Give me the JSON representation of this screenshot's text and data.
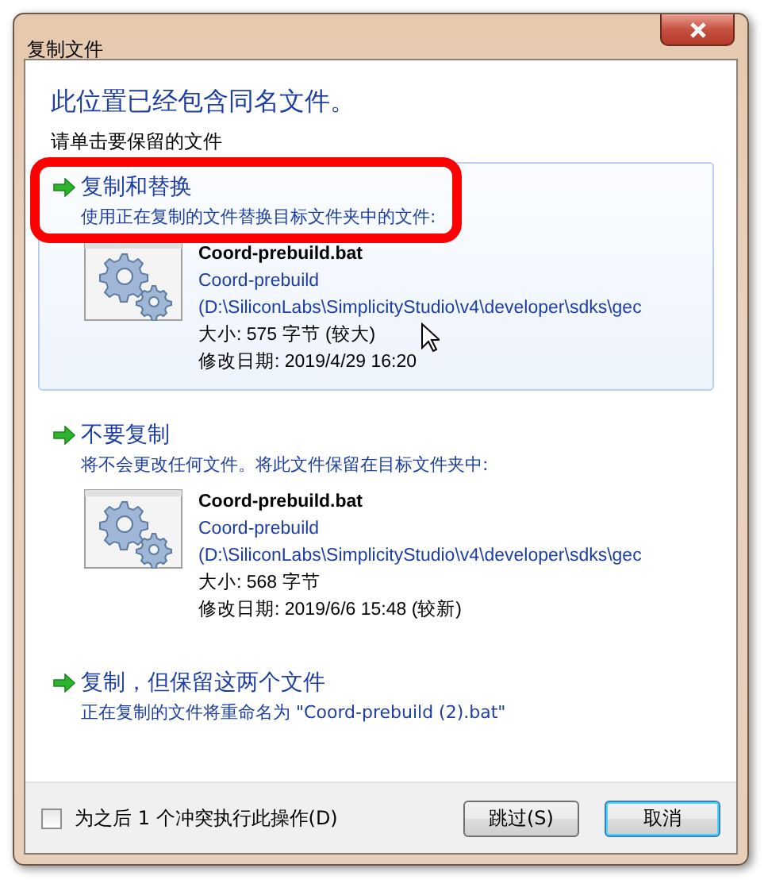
{
  "window": {
    "title": "复制文件"
  },
  "heading": "此位置已经包含同名文件。",
  "subheading": "请单击要保留的文件",
  "options": [
    {
      "title": "复制和替换",
      "description": "使用正在复制的文件替换目标文件夹中的文件:",
      "highlighted": true,
      "annotated": true,
      "file": {
        "name": "Coord-prebuild.bat",
        "folder": "Coord-prebuild",
        "path": "(D:\\SiliconLabs\\SimplicityStudio\\v4\\developer\\sdks\\gec",
        "size": "大小: 575 字节 (较大)",
        "modified": "修改日期: 2019/4/29 16:20"
      }
    },
    {
      "title": "不要复制",
      "description": "将不会更改任何文件。将此文件保留在目标文件夹中:",
      "highlighted": false,
      "annotated": false,
      "file": {
        "name": "Coord-prebuild.bat",
        "folder": "Coord-prebuild",
        "path": "(D:\\SiliconLabs\\SimplicityStudio\\v4\\developer\\sdks\\gec",
        "size": "大小: 568 字节",
        "modified": "修改日期: 2019/6/6 15:48 (较新)"
      }
    },
    {
      "title": "复制，但保留这两个文件",
      "description": "正在复制的文件将重命名为 \"Coord-prebuild (2).bat\"",
      "highlighted": false,
      "annotated": false
    }
  ],
  "footer": {
    "checkbox": {
      "label": "为之后 1 个冲突执行此操作(D)",
      "checked": false
    },
    "buttons": [
      {
        "label": "跳过(S)",
        "default": false
      },
      {
        "label": "取消",
        "default": true
      }
    ]
  }
}
